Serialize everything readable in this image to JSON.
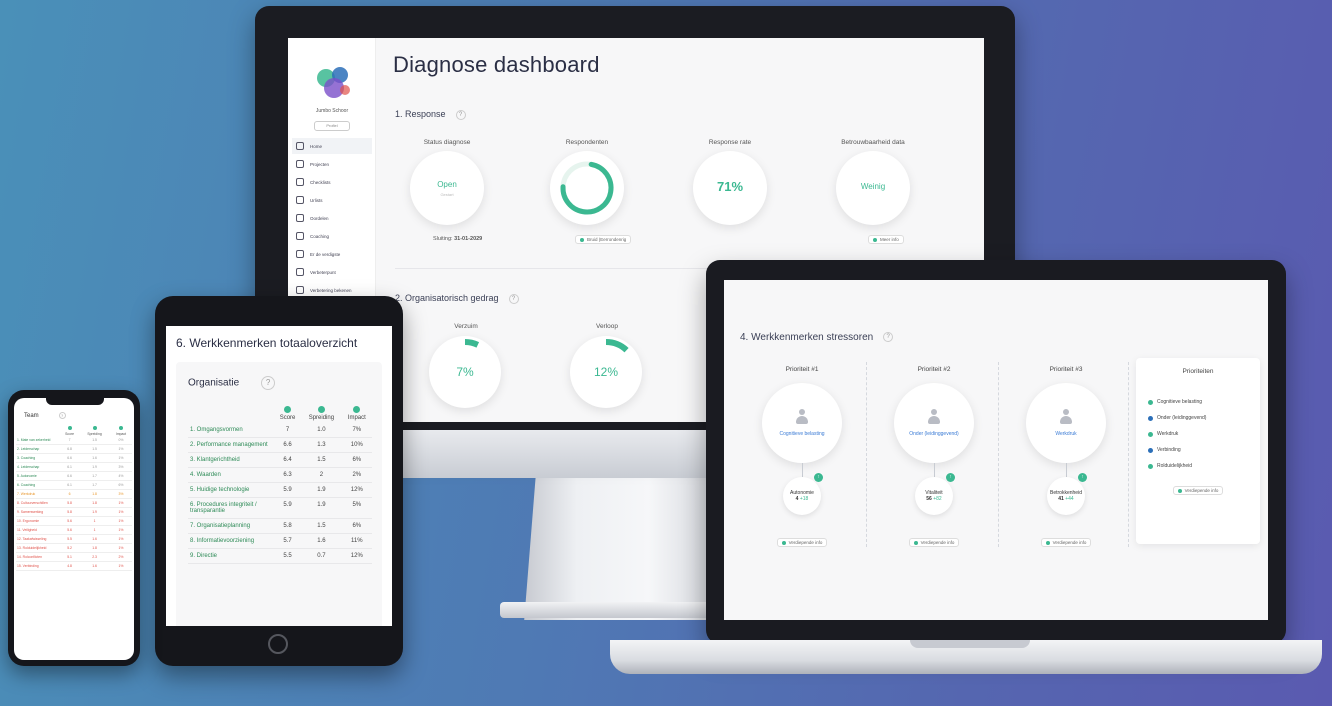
{
  "colors": {
    "accent_green": "#3bb891",
    "link_blue": "#3a7bd5",
    "warning_orange": "#e8962a",
    "danger_red": "#e0524a"
  },
  "monitor": {
    "sidebar": {
      "org_name": "Jumbo Schoor",
      "button_label": "Profiel",
      "items": [
        {
          "label": "Home",
          "icon": "home-icon"
        },
        {
          "label": "Projecten",
          "icon": "projects-icon"
        },
        {
          "label": "Checklists",
          "icon": "checklist-icon"
        },
        {
          "label": "Urlists",
          "icon": "list-icon"
        },
        {
          "label": "Oordelen",
          "icon": "edit-icon"
        },
        {
          "label": "Coaching",
          "icon": "coaching-icon"
        },
        {
          "label": "Er de verdigste",
          "icon": "chart-icon"
        },
        {
          "label": "Verbeterpunt",
          "icon": "target-icon"
        },
        {
          "label": "Verbetering bekenen",
          "icon": "cycle-icon"
        }
      ]
    },
    "title": "Diagnose dashboard",
    "section1": "1. Response",
    "section2": "2. Organisatorisch gedrag",
    "kpis": [
      {
        "label": "Status diagnose",
        "value": "Open",
        "sub": "Gestart"
      },
      {
        "label": "Respondenten",
        "value": "",
        "sub": ""
      },
      {
        "label": "Response rate",
        "value": "71%",
        "sub": ""
      },
      {
        "label": "Betrouwbaarheid data",
        "value": "Weinig",
        "sub": ""
      }
    ],
    "deadline_label": "Sluiting:",
    "deadline_value": "31-01-2029",
    "tag_respondents": "Bruid (Eerrondenrig",
    "tag_reliability": "Meer info",
    "gauges": [
      {
        "label": "Verzuim",
        "value": "7%",
        "fraction": 0.07
      },
      {
        "label": "Verloop",
        "value": "12%",
        "fraction": 0.12
      }
    ]
  },
  "laptop": {
    "title": "4. Werkkenmerken stressoren",
    "priorities": [
      {
        "heading": "Prioriteit #1",
        "category": "Cognitieve belasting",
        "bubble_label": "Autonomie",
        "bubble_value": "4",
        "bubble_delta": "+18",
        "tag": "Verdiepende info"
      },
      {
        "heading": "Prioriteit #2",
        "category": "Onder (leidinggevend)",
        "bubble_label": "Vitaliteit",
        "bubble_value": "56",
        "bubble_delta": "+82",
        "tag": "Verdiepende info"
      },
      {
        "heading": "Prioriteit #3",
        "category": "Werkdruk",
        "bubble_label": "Betrokkenheid",
        "bubble_value": "41",
        "bubble_delta": "+44",
        "tag": "Verdiepende info"
      }
    ],
    "legend": {
      "title": "Prioriteiten",
      "items": [
        {
          "label": "Cognitieve belasting",
          "color": "#3bb891"
        },
        {
          "label": "Onder (leidinggevend)",
          "color": "#2c6fb8"
        },
        {
          "label": "Werkdruk",
          "color": "#3bb891"
        },
        {
          "label": "Verbinding",
          "color": "#2c6fb8"
        },
        {
          "label": "Rolduidelijkheid",
          "color": "#3bb891"
        }
      ],
      "tag": "Verdiepende info"
    }
  },
  "tablet": {
    "title": "6. Werkkenmerken totaaloverzicht",
    "card_title": "Organisatie",
    "columns": [
      "Score",
      "Spreiding",
      "Impact"
    ],
    "rows": [
      {
        "name": "1. Omgangsvormen",
        "score": "7",
        "spread": "1.0",
        "impact": "7%"
      },
      {
        "name": "2. Performance management",
        "score": "6.6",
        "spread": "1.3",
        "impact": "10%"
      },
      {
        "name": "3. Klantgerichtheid",
        "score": "6.4",
        "spread": "1.5",
        "impact": "6%"
      },
      {
        "name": "4. Waarden",
        "score": "6.3",
        "spread": "2",
        "impact": "2%"
      },
      {
        "name": "5. Huidige technologie",
        "score": "5.9",
        "spread": "1.9",
        "impact": "12%"
      },
      {
        "name": "6. Procedures integriteit / transparantie",
        "score": "5.9",
        "spread": "1.9",
        "impact": "5%"
      },
      {
        "name": "7. Organisatieplanning",
        "score": "5.8",
        "spread": "1.5",
        "impact": "6%"
      },
      {
        "name": "8. Informatievoorziening",
        "score": "5.7",
        "spread": "1.6",
        "impact": "11%"
      },
      {
        "name": "9. Directie",
        "score": "5.5",
        "spread": "0.7",
        "impact": "12%"
      }
    ]
  },
  "phone": {
    "title": "Team",
    "columns": [
      "Score",
      "Spreiding",
      "Impact"
    ],
    "rows": [
      {
        "name": "1. Mate van zekerheid",
        "a": "7",
        "b": "1.5",
        "c": "0%",
        "status": "green"
      },
      {
        "name": "2. Leiderschap",
        "a": "6.8",
        "b": "1.5",
        "c": "1%",
        "status": "green"
      },
      {
        "name": "3. Coaching",
        "a": "6.6",
        "b": "1.6",
        "c": "1%",
        "status": "green"
      },
      {
        "name": "4. Leiderschap",
        "a": "6.1",
        "b": "1.9",
        "c": "3%",
        "status": "green"
      },
      {
        "name": "5. Autonomie",
        "a": "6.6",
        "b": "1.7",
        "c": "4%",
        "status": "green"
      },
      {
        "name": "6. Coaching",
        "a": "6.1",
        "b": "1.7",
        "c": "6%",
        "status": "green"
      },
      {
        "name": "7. Werkdruk",
        "a": "6",
        "b": "1.8",
        "c": "3%",
        "status": "orange"
      },
      {
        "name": "8. Cultuurverschillen",
        "a": "5.8",
        "b": "1.8",
        "c": "1%",
        "status": "red"
      },
      {
        "name": "9. Samenwerking",
        "a": "5.8",
        "b": "1.9",
        "c": "1%",
        "status": "red"
      },
      {
        "name": "10. Ergonomie",
        "a": "5.6",
        "b": "1",
        "c": "1%",
        "status": "red"
      },
      {
        "name": "11. Veiligheid",
        "a": "5.6",
        "b": "1",
        "c": "1%",
        "status": "red"
      },
      {
        "name": "12. Taakafwisseling",
        "a": "5.5",
        "b": "1.6",
        "c": "1%",
        "status": "red"
      },
      {
        "name": "13. Rolduidelijkheid",
        "a": "5.2",
        "b": "1.8",
        "c": "1%",
        "status": "red"
      },
      {
        "name": "14. Rolconflicten",
        "a": "5.1",
        "b": "2.3",
        "c": "2%",
        "status": "red"
      },
      {
        "name": "15. Verbinding",
        "a": "4.8",
        "b": "1.6",
        "c": "1%",
        "status": "red"
      }
    ]
  }
}
